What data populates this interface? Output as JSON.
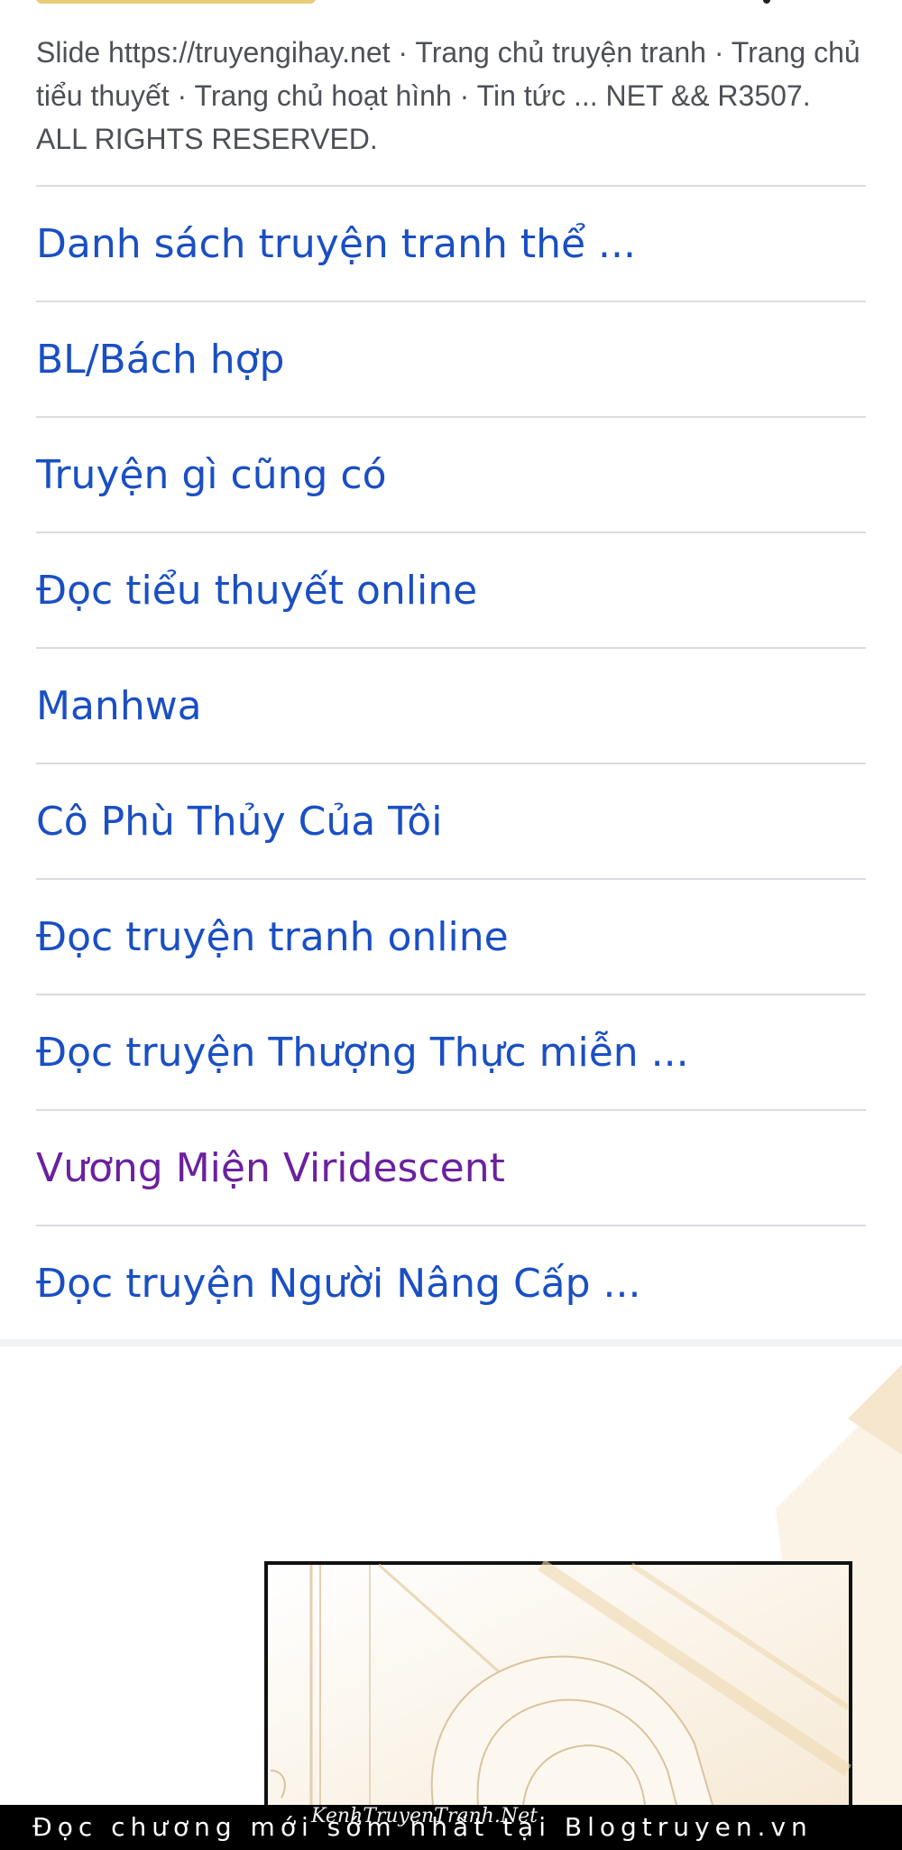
{
  "search_result": {
    "snippet": "Slide https://truyengihay.net · Trang chủ truyện tranh · Trang chủ tiểu thuyết · Trang chủ hoạt hình · Tin tức ... NET && R3507. ALL RIGHTS RESERVED."
  },
  "related_searches": [
    {
      "label": "Danh sách truyện tranh thể ...",
      "visited": false
    },
    {
      "label": "BL/Bách hợp",
      "visited": false
    },
    {
      "label": "Truyện gì cũng có",
      "visited": false
    },
    {
      "label": "Đọc tiểu thuyết online",
      "visited": false
    },
    {
      "label": "Manhwa",
      "visited": false
    },
    {
      "label": "Cô Phù Thủy Của Tôi",
      "visited": false
    },
    {
      "label": "Đọc truyện tranh online",
      "visited": false
    },
    {
      "label": "Đọc truyện Thượng Thực miễn ...",
      "visited": false
    },
    {
      "label": "Vương Miện Viridescent",
      "visited": true
    },
    {
      "label": "Đọc truyện Người Nâng Cấp ...",
      "visited": false
    }
  ],
  "footer_banner": {
    "text": "Đọc chương mới sớm nhất tại Blogtruyen.vn",
    "watermark": "KenhTruyenTranh.Net"
  },
  "colors": {
    "link": "#1a4fc4",
    "visited_link": "#6b219e",
    "snippet_text": "#4d5156",
    "divider": "#dadce0"
  }
}
